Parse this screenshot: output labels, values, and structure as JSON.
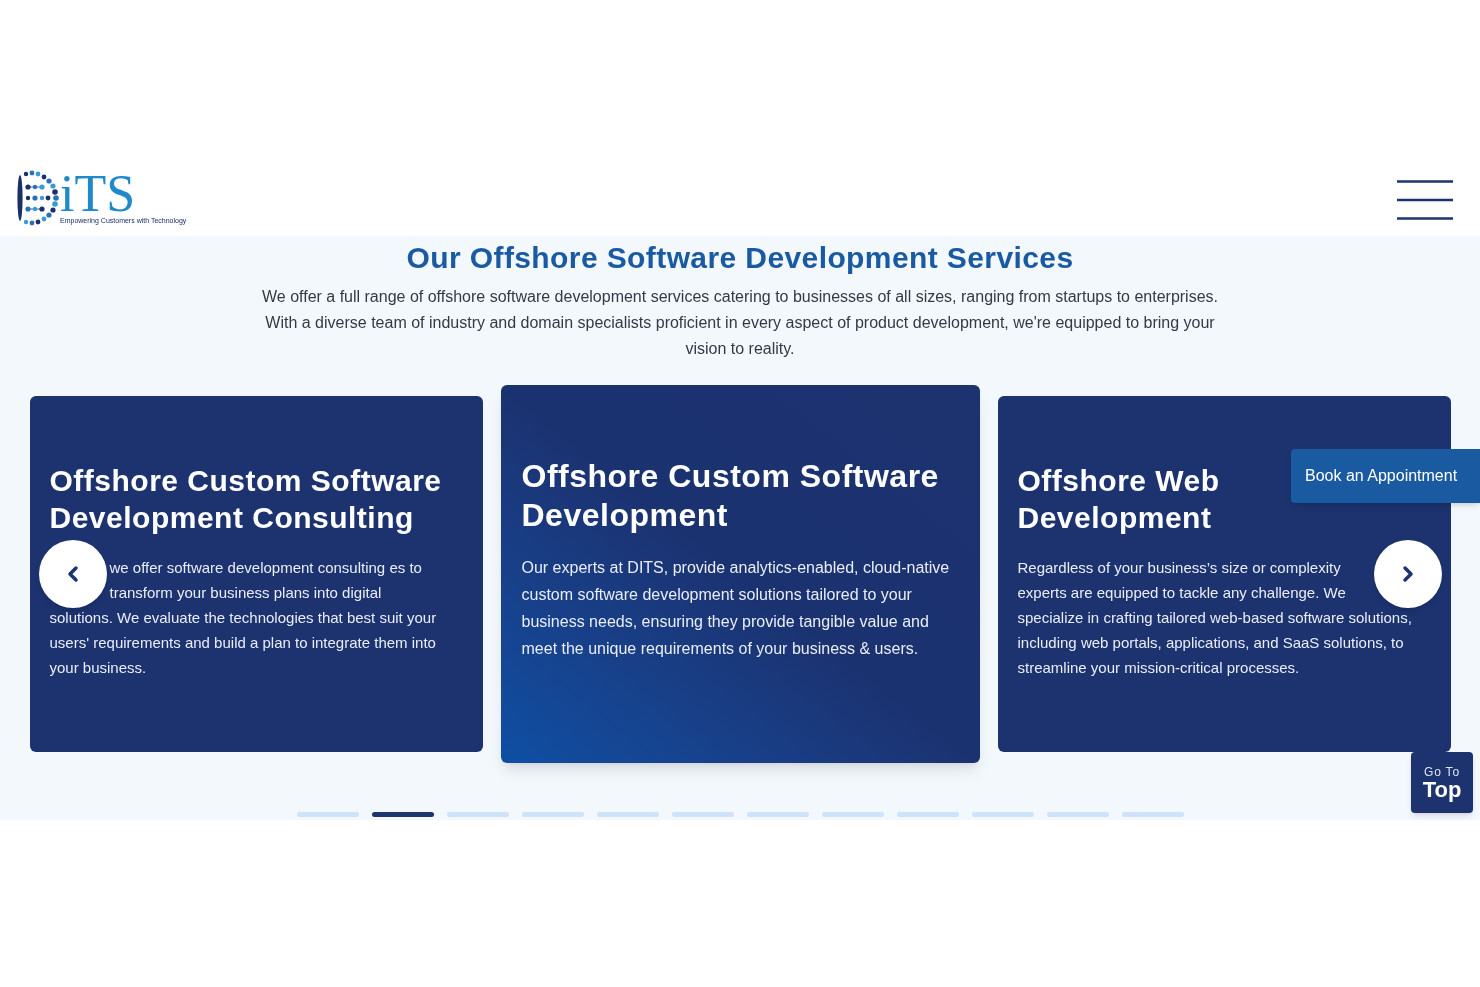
{
  "header": {
    "logo": {
      "wordmark": "iTS",
      "tagline": "Empowering Customers with Technology"
    }
  },
  "services": {
    "title": "Our Offshore Software Development Services",
    "description": "We offer a full range of offshore software development services catering to businesses of all sizes, ranging from startups to enterprises. With a diverse team of industry and domain specialists proficient in every aspect of product development, we're equipped to bring your vision to reality."
  },
  "carousel": {
    "cards": [
      {
        "title": "Offshore Custom Software Development Consulting",
        "body": [
          "we offer software development consulting es to transform your business plans into digital",
          "solutions. We evaluate the technologies that best suit your users' requirements and build a plan to integrate them into your business."
        ],
        "selected": false
      },
      {
        "title": "Offshore Custom Software Development",
        "body": [
          "Our experts at DITS, provide analytics-enabled, cloud-native custom software development solutions tailored to your business needs, ensuring they provide tangible value and meet the unique requirements of your business & users."
        ],
        "selected": true
      },
      {
        "title": "Offshore Web Development",
        "body": [
          "Regardless of your business’s size or complexity experts are equipped to tackle any challenge. We",
          "specialize in crafting tailored web-based software solutions, including web portals, applications, and SaaS solutions, to streamline your mission-critical processes."
        ],
        "selected": false
      }
    ],
    "pagination": [
      {
        "selected": false
      },
      {
        "selected": true
      },
      {
        "selected": false
      },
      {
        "selected": false
      },
      {
        "selected": false
      },
      {
        "selected": false
      },
      {
        "selected": false
      },
      {
        "selected": false
      },
      {
        "selected": false
      },
      {
        "selected": false
      },
      {
        "selected": false
      },
      {
        "selected": false
      }
    ]
  },
  "book_appointment_button": "Book an Appointment",
  "go_to_top_button": {
    "line_1": "Go To",
    "line_2": "Top"
  }
}
